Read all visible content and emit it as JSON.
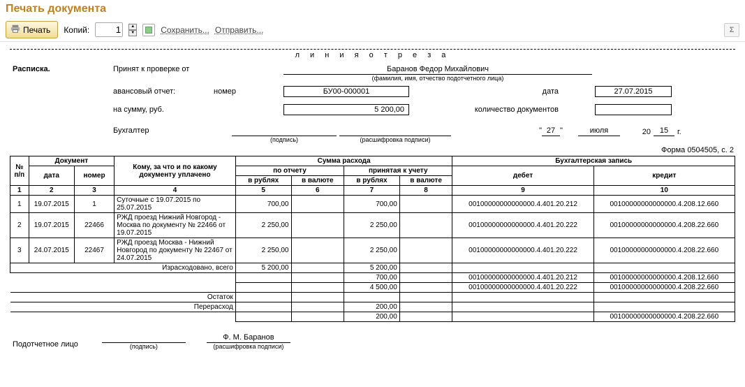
{
  "pageTitle": "Печать документа",
  "toolbar": {
    "printLabel": "Печать",
    "copiesLabel": "Копий:",
    "copiesValue": "1",
    "saveLabel": "Сохранить...",
    "sendLabel": "Отправить...",
    "sigma": "Σ"
  },
  "cut": {
    "label": "л и н и я    о т р е з а"
  },
  "receipt": {
    "title": "Расписка.",
    "acceptedFromLabel": "Принят к проверке от",
    "acceptedFrom": "Баранов Федор Михайлович",
    "fioNote": "(фамилия, имя, отчество подотчетного лица)",
    "advanceReportLabel": "авансовый отчет:",
    "numberLabel": "номер",
    "number": "БУ00-000001",
    "dateLabel": "дата",
    "date": "27.07.2015",
    "sumLabel": "на сумму, руб.",
    "sum": "5 200,00",
    "docsCountLabel": "количество документов",
    "docsCount": "",
    "accountantLabel": "Бухгалтер",
    "signNote": "(подпись)",
    "nameNote": "(расшифровка подписи)",
    "dQuote": "\"",
    "day": "27",
    "month": "июля",
    "yearPrefix": "20",
    "yearSuffix": "15",
    "yearG": "г."
  },
  "formCode": "Форма 0504505, с. 2",
  "tableHead": {
    "no": "№ п/п",
    "doc": "Документ",
    "date": "дата",
    "num": "номер",
    "whom": "Кому, за что и по какому документу уплачено",
    "sum": "Сумма расхода",
    "byReport": "по отчету",
    "accepted": "принятая к учету",
    "rub": "в рублях",
    "val": "в валюте",
    "entry": "Бухгалтерская запись",
    "debit": "дебет",
    "credit": "кредит"
  },
  "colNums": [
    "1",
    "2",
    "3",
    "4",
    "5",
    "6",
    "7",
    "8",
    "9",
    "10"
  ],
  "rows": [
    {
      "no": "1",
      "date": "19.07.2015",
      "num": "1",
      "desc": "Суточные с 19.07.2015 по 25.07.2015",
      "rub1": "700,00",
      "val1": "",
      "rub2": "700,00",
      "val2": "",
      "db": "00100000000000000.4.401.20.212",
      "cr": "00100000000000000.4.208.12.660"
    },
    {
      "no": "2",
      "date": "19.07.2015",
      "num": "22466",
      "desc": "РЖД проезд Нижний Новгород - Москва по документу № 22466 от 19.07.2015",
      "rub1": "2 250,00",
      "val1": "",
      "rub2": "2 250,00",
      "val2": "",
      "db": "00100000000000000.4.401.20.222",
      "cr": "00100000000000000.4.208.22.660"
    },
    {
      "no": "3",
      "date": "24.07.2015",
      "num": "22467",
      "desc": "РЖД проезд Москва - Нижний Новгород по документу № 22467 от 24.07.2015",
      "rub1": "2 250,00",
      "val1": "",
      "rub2": "2 250,00",
      "val2": "",
      "db": "00100000000000000.4.401.20.222",
      "cr": "00100000000000000.4.208.22.660"
    }
  ],
  "totalsLabel": "Израсходовано, всего",
  "totals": {
    "rub1": "5 200,00",
    "val1": "",
    "rub2": "5 200,00",
    "val2": ""
  },
  "split": [
    {
      "rub2": "700,00",
      "db": "00100000000000000.4.401.20.212",
      "cr": "00100000000000000.4.208.12.660"
    },
    {
      "rub2": "4 500,00",
      "db": "00100000000000000.4.401.20.222",
      "cr": "00100000000000000.4.208.22.660"
    }
  ],
  "remainderLabel": "Остаток",
  "overrunLabel": "Перерасход",
  "overrun": {
    "rub2": "200,00"
  },
  "overrun2": {
    "rub2": "200,00",
    "cr": "00100000000000000.4.208.22.660"
  },
  "signature": {
    "label": "Подотчетное лицо",
    "signNote": "(подпись)",
    "name": "Ф. М. Баранов",
    "nameNote": "(расшифровка подписи)"
  }
}
